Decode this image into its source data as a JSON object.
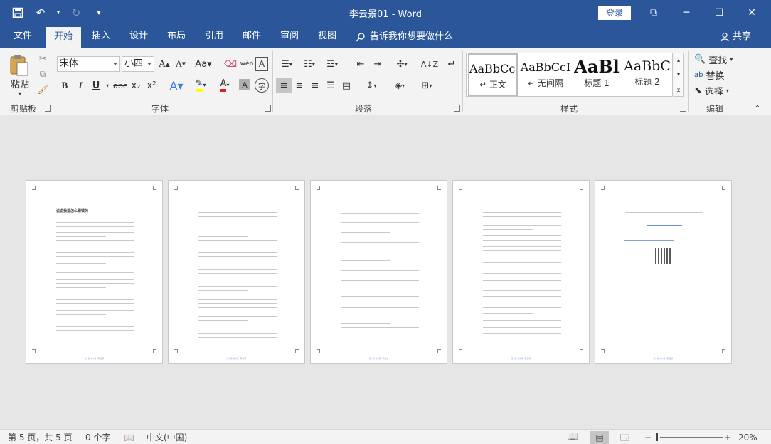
{
  "title_bar": {
    "document_title": "李云景01 - Word",
    "login_label": "登录",
    "qat": [
      {
        "name": "save-icon",
        "glyph": "💾"
      },
      {
        "name": "undo-icon",
        "glyph": "↶"
      },
      {
        "name": "redo-icon",
        "glyph": "↻"
      },
      {
        "name": "customize-qat-icon",
        "glyph": "▾"
      }
    ],
    "window_buttons": [
      {
        "name": "ribbon-display-options-icon",
        "glyph": "⧉"
      },
      {
        "name": "minimize-icon",
        "glyph": "─"
      },
      {
        "name": "maximize-icon",
        "glyph": "☐"
      },
      {
        "name": "close-icon",
        "glyph": "✕"
      }
    ]
  },
  "tabs": [
    "文件",
    "开始",
    "插入",
    "设计",
    "布局",
    "引用",
    "邮件",
    "审阅",
    "视图"
  ],
  "active_tab": "开始",
  "tell_me": "告诉我你想要做什么",
  "share": "共享",
  "ribbon": {
    "clipboard": {
      "paste_label": "粘贴",
      "group_label": "剪贴板"
    },
    "font": {
      "font_name": "宋体",
      "font_size": "小四",
      "group_label": "字体",
      "buttons": [
        "B",
        "I",
        "U",
        "abc",
        "x₂",
        "x²"
      ]
    },
    "paragraph": {
      "group_label": "段落"
    },
    "styles": {
      "group_label": "样式",
      "items": [
        {
          "sample": "AaBbCcI",
          "name": "↵ 正文"
        },
        {
          "sample": "AaBbCcI",
          "name": "↵ 无间隔"
        },
        {
          "sample": "AaBl",
          "name": "标题 1"
        },
        {
          "sample": "AaBbC",
          "name": "标题 2"
        }
      ]
    },
    "editing": {
      "group_label": "编辑",
      "find_label": "查找",
      "replace_label": "替换",
      "select_label": "选择"
    }
  },
  "document": {
    "page1_title": "说说我是怎么赚钱的",
    "page_footer": "第1页 共5页 ·李云景"
  },
  "status_bar": {
    "page_info": "第 5 页，共 5 页",
    "word_count": "0 个字",
    "language": "中文(中国)",
    "zoom": "20%"
  },
  "colors": {
    "brand": "#2b579a",
    "ribbon_bg": "#f3f3f3",
    "canvas_bg": "#e6e6e6"
  }
}
